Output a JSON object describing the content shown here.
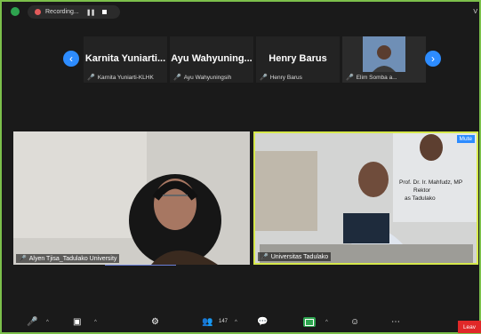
{
  "top_bar": {
    "recording_label": "Recording...",
    "view_label": "V"
  },
  "participants_strip": [
    {
      "display_name": "Karnita Yuniarti...",
      "full_name": "Karnita Yuniarti-KLHK"
    },
    {
      "display_name": "Ayu Wahyuning...",
      "full_name": "Ayu Wahyuningsih"
    },
    {
      "display_name": "Henry Barus",
      "full_name": "Henry Barus"
    },
    {
      "display_name": "",
      "full_name": "Elim Somba a..."
    }
  ],
  "main_videos": [
    {
      "name": "Alyen Tjisa_Tadulako University"
    },
    {
      "name": "Universitas Tadulako",
      "badge": "Mute",
      "slide_text_1": "Prof. Dr. Ir. Mahfudz, MP",
      "slide_text_2": "Rektor",
      "slide_text_3": "as Tadulako"
    }
  ],
  "toolbar": {
    "participants_count": "147",
    "leave_label": "Leav"
  },
  "colors": {
    "active_speaker_border": "#d6e84b",
    "zoom_blue": "#2d8cff",
    "recording_red": "#e35b5b",
    "leave_red": "#e02828"
  }
}
